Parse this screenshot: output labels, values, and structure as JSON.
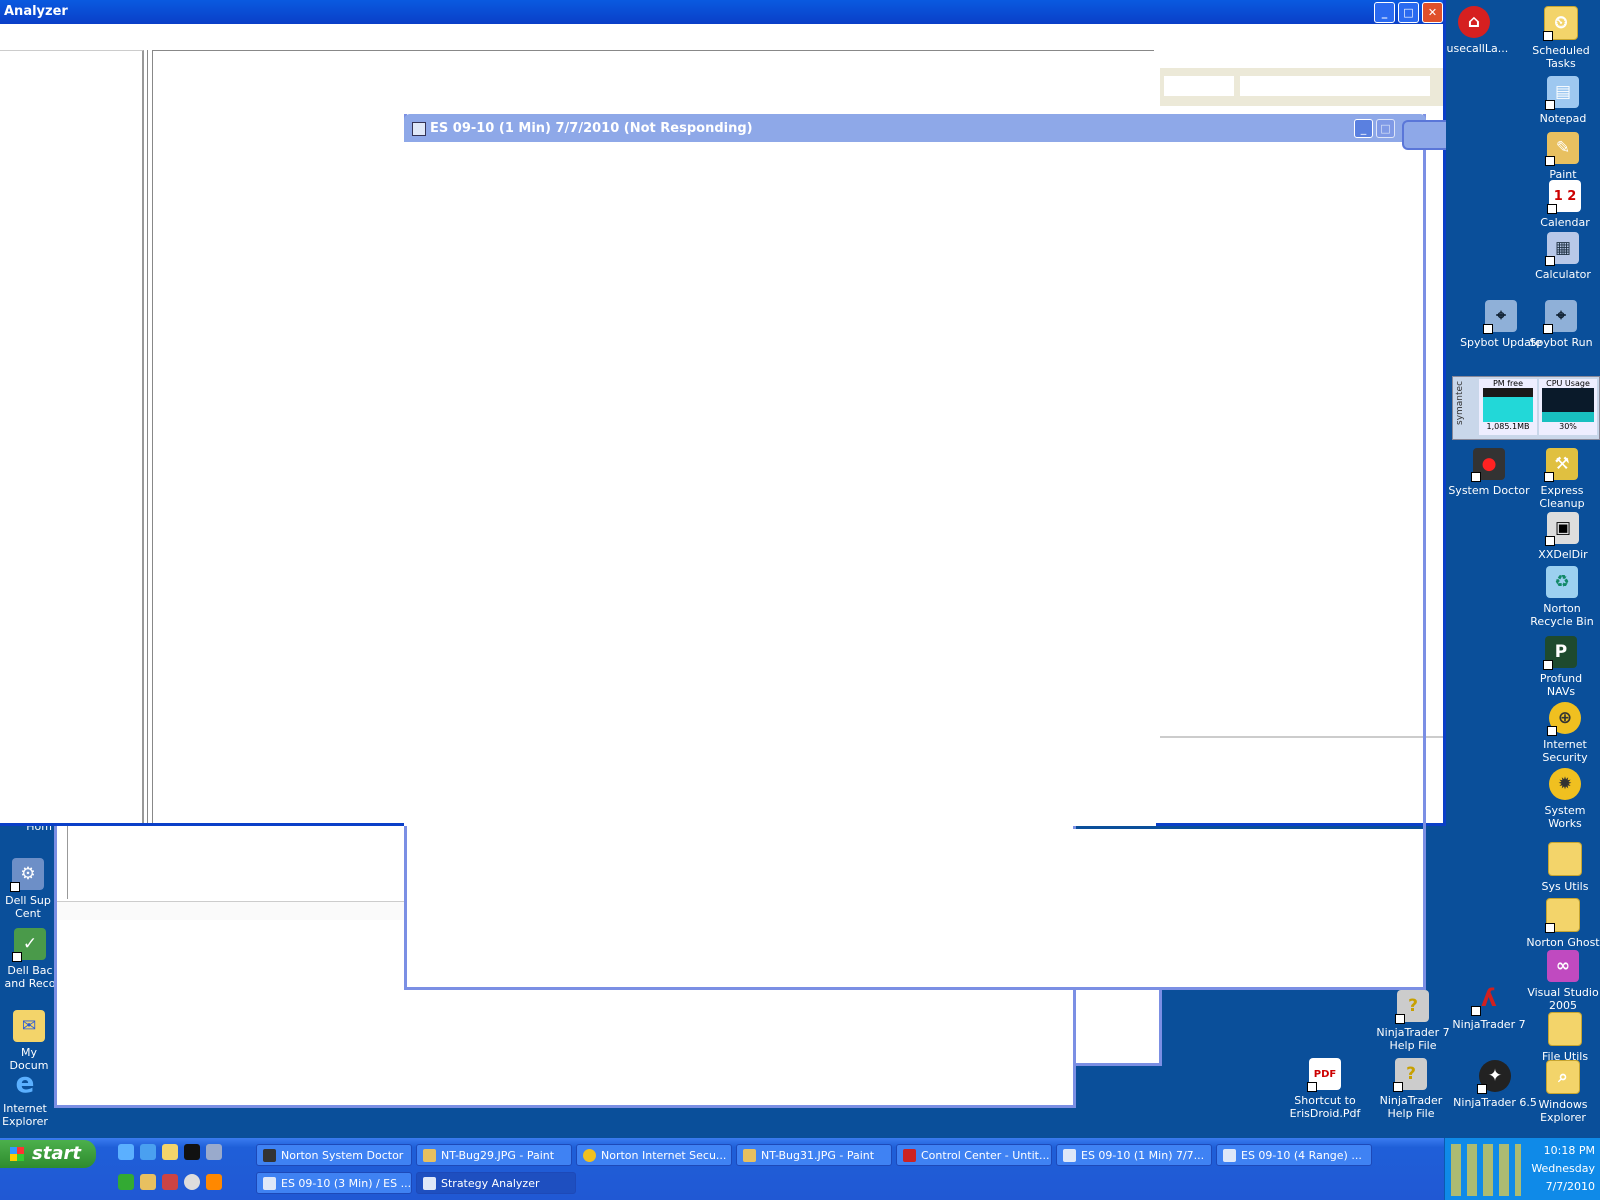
{
  "strategy_window": {
    "title": "Analyzer"
  },
  "chart_window": {
    "title": "ES 09-10 (1 Min)  7/7/2010 (Not Responding)"
  },
  "desktop_icons_right": [
    {
      "label": "ousecallLa...",
      "icon": "housecall-icon"
    },
    {
      "label": "Scheduled Tasks",
      "icon": "folder-clock-icon"
    },
    {
      "label": "Notepad",
      "icon": "notepad-icon"
    },
    {
      "label": "Paint",
      "icon": "paint-icon"
    },
    {
      "label": "Calendar",
      "icon": "calendar-icon"
    },
    {
      "label": "Calculator",
      "icon": "calculator-icon"
    },
    {
      "label": "Spybot Update",
      "icon": "spybot-icon"
    },
    {
      "label": "Spybot Run",
      "icon": "spybot-icon"
    },
    {
      "label": "System Doctor",
      "icon": "traffic-light-icon"
    },
    {
      "label": "Express Cleanup",
      "icon": "broom-icon"
    },
    {
      "label": "XXDelDir",
      "icon": "terminal-icon"
    },
    {
      "label": "Norton Recycle Bin",
      "icon": "recycle-bin-icon"
    },
    {
      "label": "Profund NAVs",
      "icon": "p-icon"
    },
    {
      "label": "Internet Security",
      "icon": "globe-icon"
    },
    {
      "label": "System Works",
      "icon": "gear-icon"
    },
    {
      "label": "Sys Utils",
      "icon": "folder-icon"
    },
    {
      "label": "Norton Ghost",
      "icon": "ghost-icon"
    },
    {
      "label": "Visual Studio 2005",
      "icon": "visual-studio-icon"
    },
    {
      "label": "NinjaTrader 7",
      "icon": "ninja-icon"
    },
    {
      "label": "File Utils",
      "icon": "folder-icon"
    },
    {
      "label": "NinjaTrader 7 Help File",
      "icon": "help-icon"
    },
    {
      "label": "Shortcut to ErisDroid.Pdf",
      "icon": "pdf-icon"
    },
    {
      "label": "NinjaTrader Help File",
      "icon": "help-icon"
    },
    {
      "label": "NinjaTrader 6.5",
      "icon": "ninja-icon"
    },
    {
      "label": "Windows Explorer",
      "icon": "folder-search-icon"
    }
  ],
  "desktop_icons_left": [
    {
      "label": "Hom",
      "icon": "home-icon"
    },
    {
      "label": "Dell Sup Cent",
      "icon": "dell-icon"
    },
    {
      "label": "Dell Bac and Reco",
      "icon": "backup-icon"
    },
    {
      "label": "My Docum",
      "icon": "documents-icon"
    },
    {
      "label": "Internet Explorer",
      "icon": "ie-icon"
    }
  ],
  "gadget": {
    "brand": "symantec",
    "pm_label": "PM free",
    "pm_value": "1,085.1MB",
    "cpu_label": "CPU Usage",
    "cpu_value": "30%",
    "pm_fill": 0.75,
    "cpu_fill": 0.3
  },
  "taskbar": {
    "start_label": "start",
    "row1": [
      {
        "label": "Norton System Doctor",
        "icon": "traffic-light-icon"
      },
      {
        "label": "NT-Bug29.JPG - Paint",
        "icon": "paint-icon"
      },
      {
        "label": "Norton Internet Secu...",
        "icon": "globe-icon"
      },
      {
        "label": "NT-Bug31.JPG - Paint",
        "icon": "paint-icon"
      },
      {
        "label": "Control Center - Untit...",
        "icon": "ninja-icon"
      },
      {
        "label": "ES 09-10 (1 Min)  7/7...",
        "icon": "chart-icon"
      },
      {
        "label": "ES 09-10 (4 Range)  ...",
        "icon": "chart-icon"
      }
    ],
    "row2": [
      {
        "label": "ES 09-10 (3 Min) / ES ...",
        "icon": "chart-icon"
      },
      {
        "label": "Strategy Analyzer",
        "icon": "chart-icon",
        "active": true
      }
    ],
    "clock": {
      "time": "10:18 PM",
      "day": "Wednesday",
      "date": "7/7/2010"
    }
  },
  "colors": {
    "desktop": "#0a4f9a",
    "xp_blue": "#0a3fc8",
    "unresponsive_title": "#8ea8e8"
  }
}
